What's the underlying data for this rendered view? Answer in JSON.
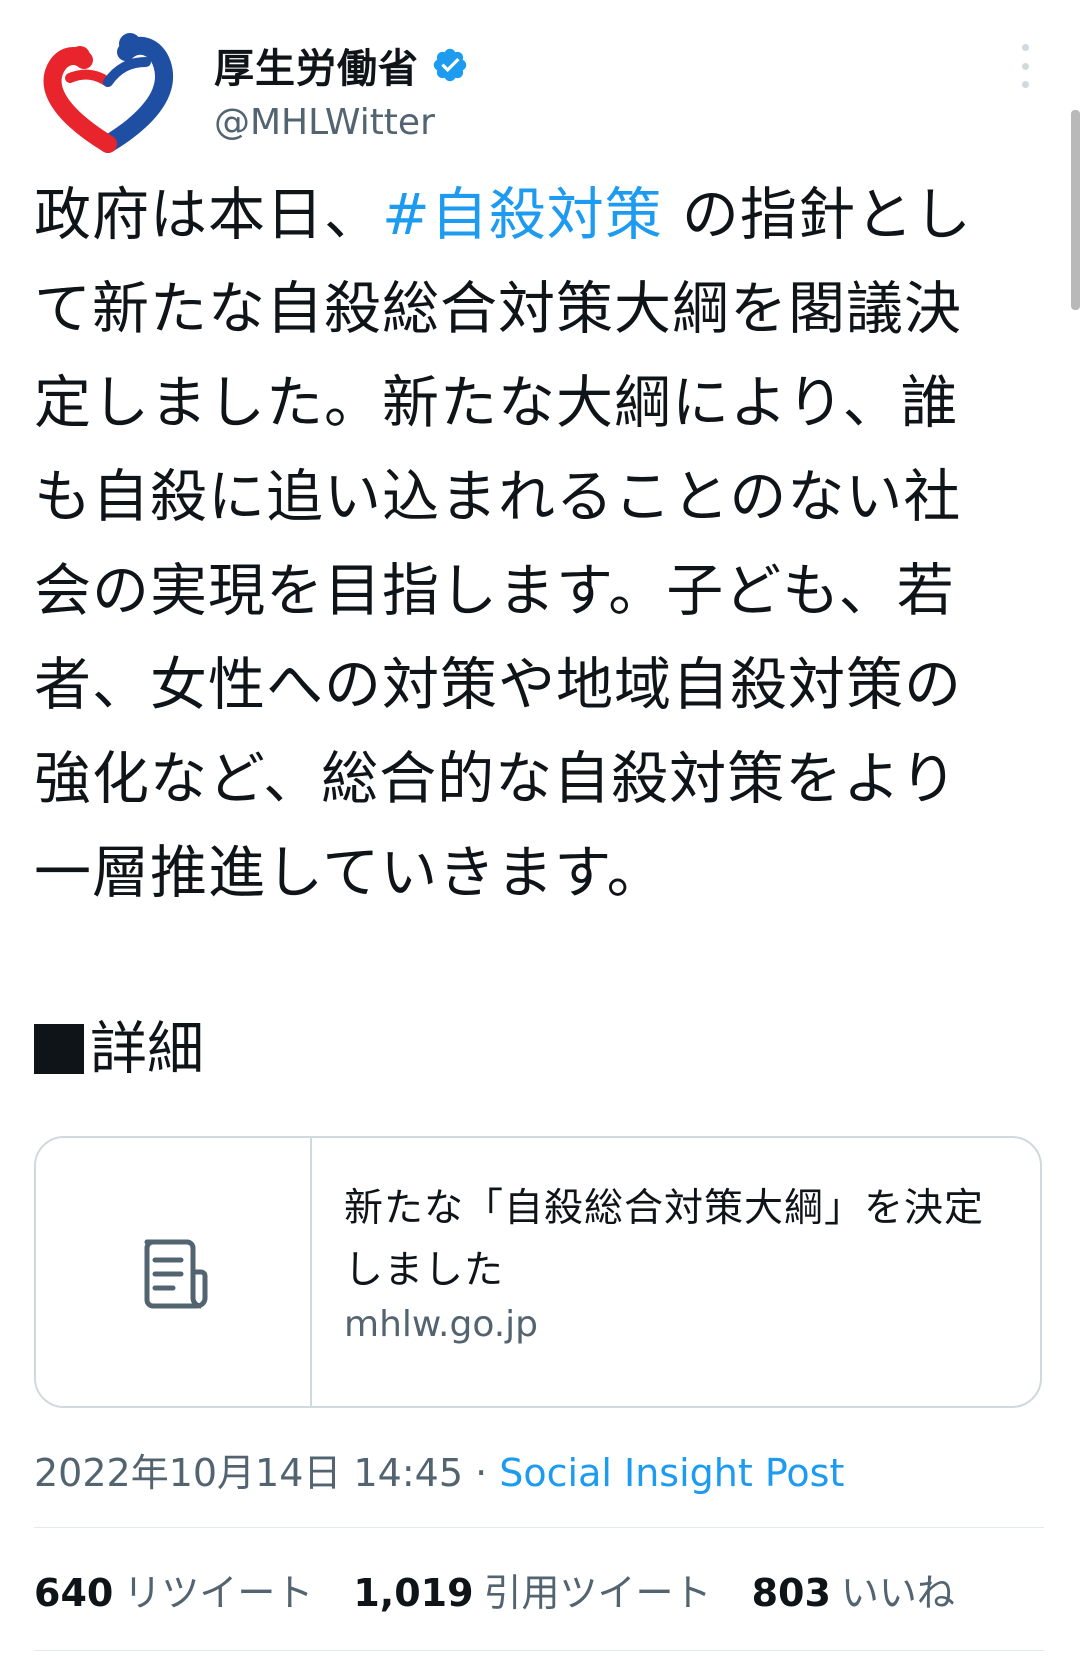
{
  "header": {
    "display_name": "厚生労働省",
    "handle": "@MHLWitter",
    "verified_icon": "verified-badge-icon",
    "more_icon": "more-options-icon"
  },
  "colors": {
    "accent": "#1d9bf0",
    "text_primary": "#0f1419",
    "text_secondary": "#536471",
    "border": "#cfd9de",
    "logo_red": "#e8242c",
    "logo_blue": "#1e4fa3"
  },
  "tweet": {
    "lines": [
      {
        "pre": "政府は本日、",
        "hashtag": "#自殺対策",
        "post": " の指針とし"
      },
      {
        "text": "て新たな自殺総合対策大綱を閣議決"
      },
      {
        "text": "定しました。新たな大綱により、誰"
      },
      {
        "text": "も自殺に追い込まれることのない社"
      },
      {
        "text": "会の実現を目指します。子ども、若"
      },
      {
        "text": "者、女性への対策や地域自殺対策の"
      },
      {
        "text": "強化など、総合的な自殺対策をより"
      },
      {
        "text": "一層推進していきます。"
      }
    ],
    "details_label": "詳細"
  },
  "link_card": {
    "thumbnail_icon": "document-icon",
    "title": "新たな「自殺総合対策大綱」を決定しました",
    "domain": "mhlw.go.jp"
  },
  "meta": {
    "timestamp": "2022年10月14日 14:45",
    "separator": " · ",
    "source": "Social Insight Post"
  },
  "stats": {
    "retweets": {
      "count": "640",
      "label": "リツイート"
    },
    "quotes": {
      "count": "1,019",
      "label": "引用ツイート"
    },
    "likes": {
      "count": "803",
      "label": "いいね"
    }
  }
}
